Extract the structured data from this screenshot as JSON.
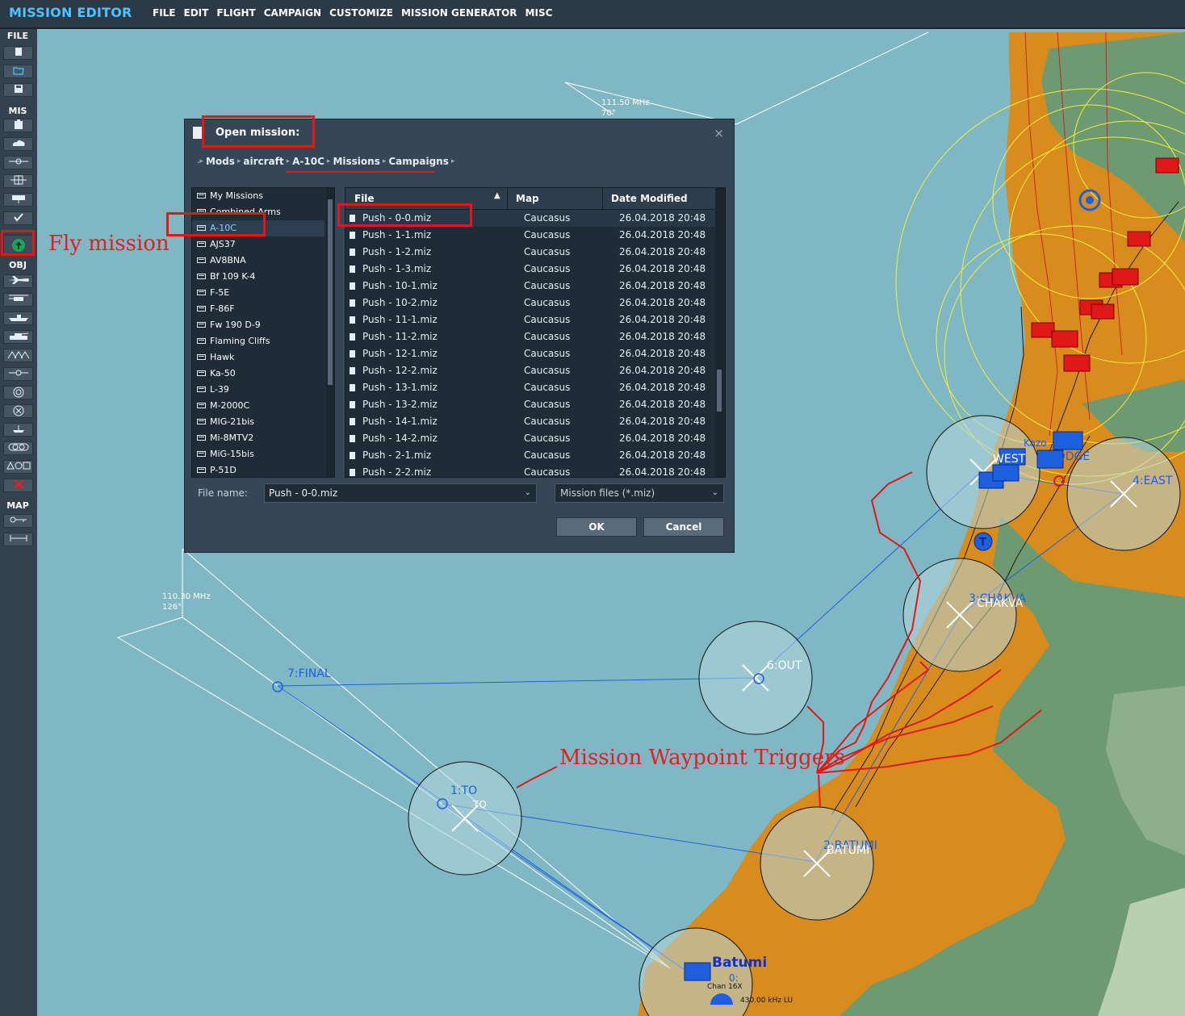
{
  "app": {
    "title": "MISSION EDITOR"
  },
  "menu": [
    "FILE",
    "EDIT",
    "FLIGHT",
    "CAMPAIGN",
    "CUSTOMIZE",
    "MISSION GENERATOR",
    "MISC"
  ],
  "toolbar": {
    "sections": {
      "file": "FILE",
      "mis": "MIS",
      "obj": "OBJ",
      "map": "MAP"
    }
  },
  "annotations": {
    "fly_mission": "Fly mission",
    "waypoint_triggers": "Mission Waypoint Triggers"
  },
  "map": {
    "waypoints": [
      {
        "label": "7:FINAL"
      },
      {
        "label": "6:OUT"
      },
      {
        "label": "1:TO"
      },
      {
        "label": "2:BATUMI"
      },
      {
        "label": "3:CHAKVA"
      },
      {
        "label": "4:EAST"
      }
    ],
    "extra_labels": {
      "to": "TO",
      "batumi_overlay": "BATUMI",
      "chakva_overlay": "CHAKVA",
      "west": "WEST",
      "dodge": "DODGE",
      "kazo": "Kazo"
    },
    "freq_labels": [
      {
        "freq": "111.50 MHz",
        "deg": "70°"
      },
      {
        "freq": "110.30 MHz",
        "deg": "126°"
      }
    ],
    "airfield": {
      "name": "Batumi",
      "tacan": "Chan 16X",
      "ndb": "430.00 kHz LU",
      "code": "0:"
    }
  },
  "dialog": {
    "title": "Open mission:",
    "breadcrumb": [
      "Mods",
      "aircraft",
      "A-10C",
      "Missions",
      "Campaigns"
    ],
    "folders": [
      "My Missions",
      "Combined Arms",
      "A-10C",
      "AJS37",
      "AV8BNA",
      "Bf 109 K-4",
      "F-5E",
      "F-86F",
      "Fw 190 D-9",
      "Flaming Cliffs",
      "Hawk",
      "Ka-50",
      "L-39",
      "M-2000C",
      "MIG-21bis",
      "Mi-8MTV2",
      "MiG-15bis",
      "P-51D"
    ],
    "selected_folder": "A-10C",
    "columns": {
      "file": "File",
      "map": "Map",
      "date": "Date Modified"
    },
    "files": [
      {
        "name": "Push - 0-0.miz",
        "map": "Caucasus",
        "date": "26.04.2018 20:48"
      },
      {
        "name": "Push - 1-1.miz",
        "map": "Caucasus",
        "date": "26.04.2018 20:48"
      },
      {
        "name": "Push - 1-2.miz",
        "map": "Caucasus",
        "date": "26.04.2018 20:48"
      },
      {
        "name": "Push - 1-3.miz",
        "map": "Caucasus",
        "date": "26.04.2018 20:48"
      },
      {
        "name": "Push - 10-1.miz",
        "map": "Caucasus",
        "date": "26.04.2018 20:48"
      },
      {
        "name": "Push - 10-2.miz",
        "map": "Caucasus",
        "date": "26.04.2018 20:48"
      },
      {
        "name": "Push - 11-1.miz",
        "map": "Caucasus",
        "date": "26.04.2018 20:48"
      },
      {
        "name": "Push - 11-2.miz",
        "map": "Caucasus",
        "date": "26.04.2018 20:48"
      },
      {
        "name": "Push - 12-1.miz",
        "map": "Caucasus",
        "date": "26.04.2018 20:48"
      },
      {
        "name": "Push - 12-2.miz",
        "map": "Caucasus",
        "date": "26.04.2018 20:48"
      },
      {
        "name": "Push - 13-1.miz",
        "map": "Caucasus",
        "date": "26.04.2018 20:48"
      },
      {
        "name": "Push - 13-2.miz",
        "map": "Caucasus",
        "date": "26.04.2018 20:48"
      },
      {
        "name": "Push - 14-1.miz",
        "map": "Caucasus",
        "date": "26.04.2018 20:48"
      },
      {
        "name": "Push - 14-2.miz",
        "map": "Caucasus",
        "date": "26.04.2018 20:48"
      },
      {
        "name": "Push - 2-1.miz",
        "map": "Caucasus",
        "date": "26.04.2018 20:48"
      },
      {
        "name": "Push - 2-2.miz",
        "map": "Caucasus",
        "date": "26.04.2018 20:48"
      }
    ],
    "filename_label": "File name:",
    "filename_value": "Push - 0-0.miz",
    "filetype": "Mission files (*.miz)",
    "ok": "OK",
    "cancel": "Cancel"
  },
  "colors": {
    "accent": "#4fc3ff",
    "annotation": "#e02020",
    "sea": "#7fb8c4",
    "land_orange": "#d98c1e",
    "land_green": "#6e9a72"
  }
}
